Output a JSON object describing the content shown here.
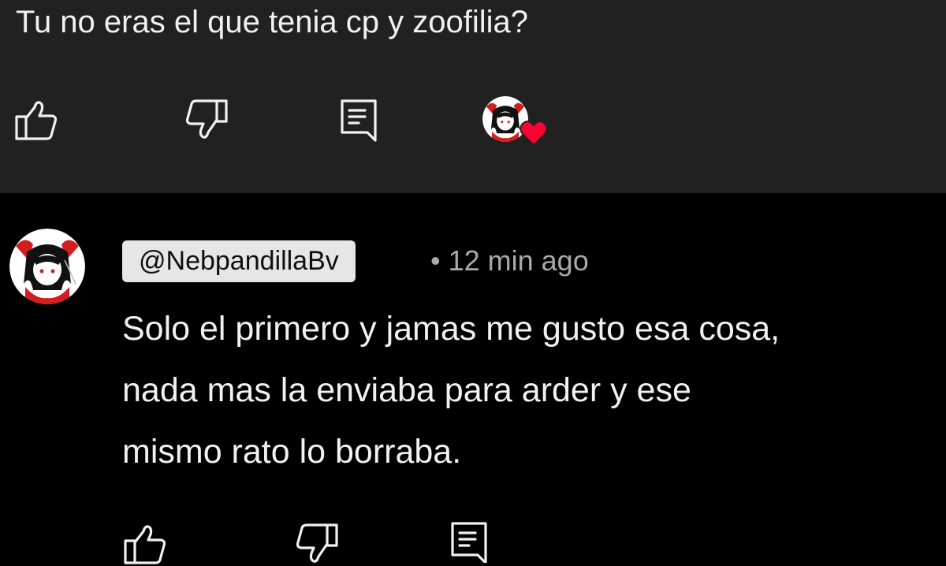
{
  "parent_comment": {
    "text": "Tu no eras el que tenia cp y zoofilia?",
    "actions": {
      "like_icon": "thumbs-up-icon",
      "dislike_icon": "thumbs-down-icon",
      "reply_icon": "comment-icon",
      "creator_heart_icon": "heart-icon"
    }
  },
  "reply": {
    "author": "@NebpandillaBv",
    "time": "• 12 min ago",
    "lines": [
      "Solo el primero y jamas me gusto esa cosa,",
      "nada mas la enviaba para arder y ese",
      "mismo rato lo borraba."
    ],
    "actions": {
      "like_icon": "thumbs-up-icon",
      "dislike_icon": "thumbs-down-icon",
      "reply_icon": "comment-icon"
    }
  },
  "colors": {
    "panel": "#212121",
    "background": "#000000",
    "text": "#f1f1f1",
    "secondary_text": "#aaaaaa",
    "chip": "#e6e6e6",
    "heart": "#ff0033"
  }
}
